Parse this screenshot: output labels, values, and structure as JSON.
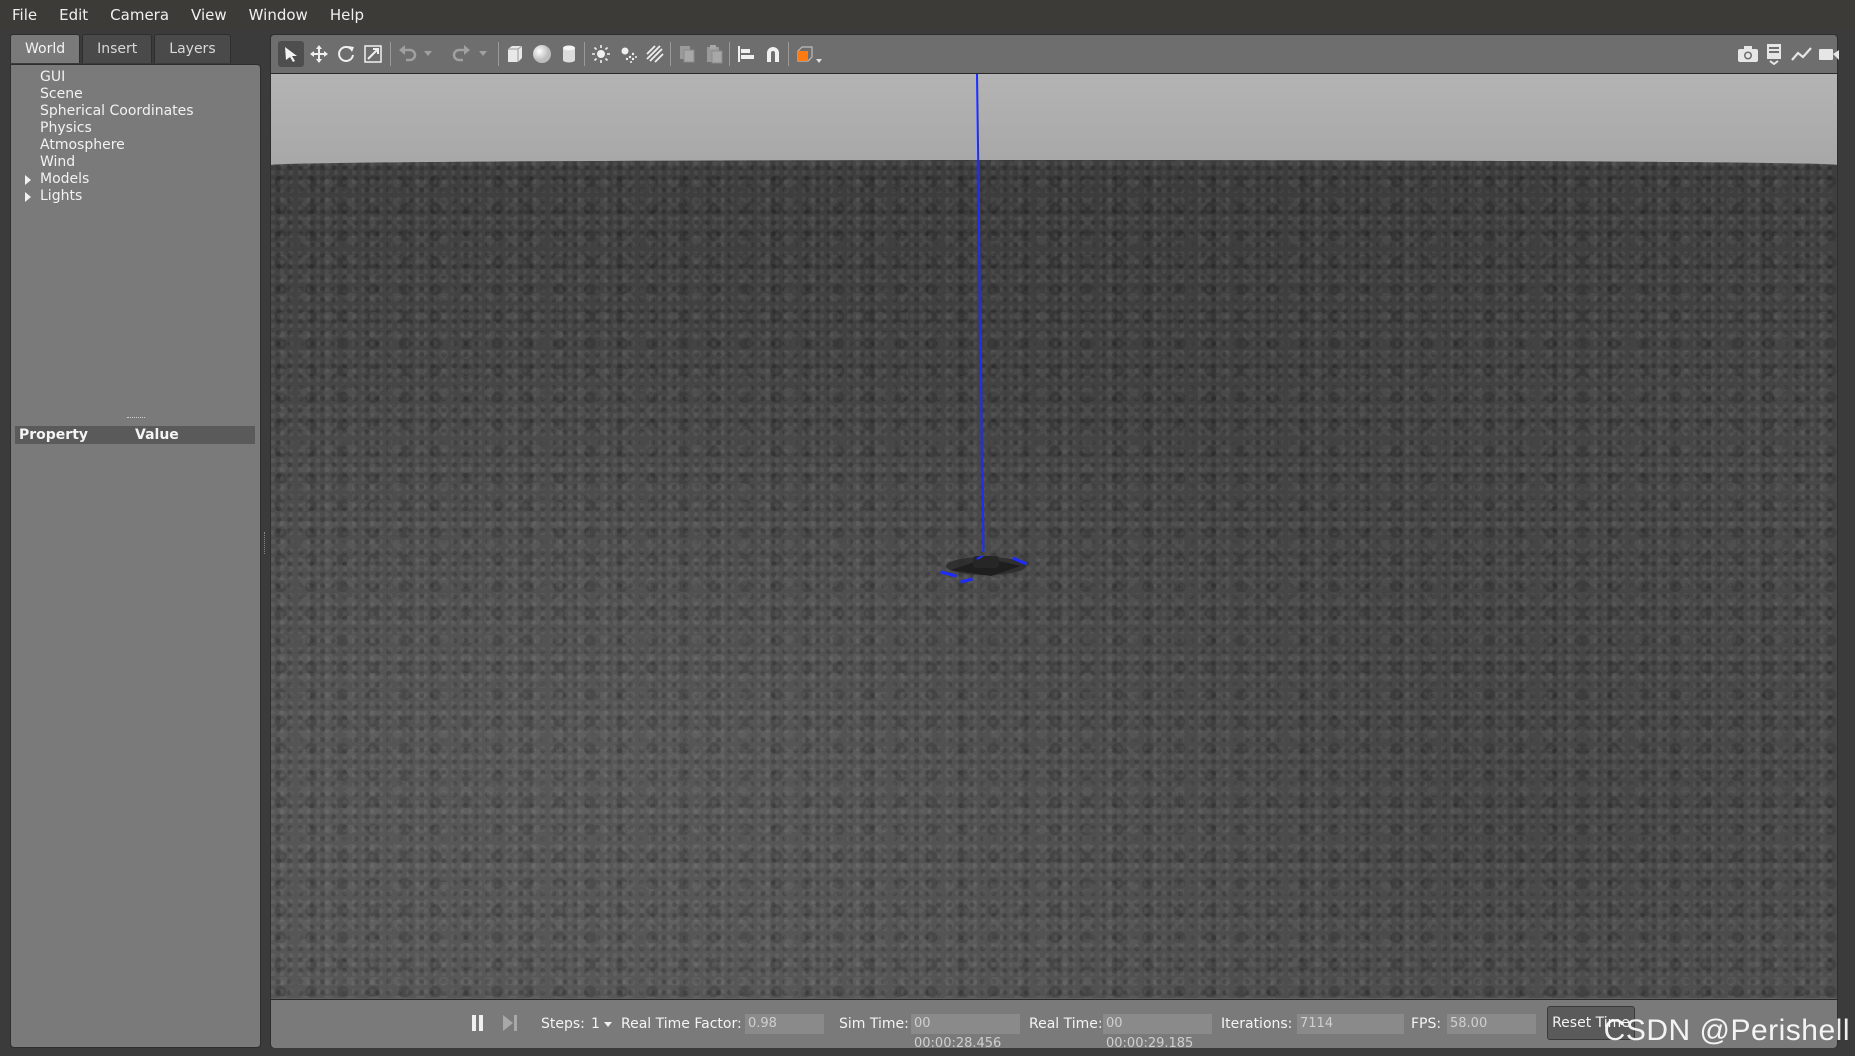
{
  "menubar": {
    "items": [
      {
        "label": "File"
      },
      {
        "label": "Edit"
      },
      {
        "label": "Camera"
      },
      {
        "label": "View"
      },
      {
        "label": "Window"
      },
      {
        "label": "Help"
      }
    ]
  },
  "left_panel": {
    "tabs": [
      {
        "label": "World",
        "active": true
      },
      {
        "label": "Insert",
        "active": false
      },
      {
        "label": "Layers",
        "active": false
      }
    ],
    "tree": [
      {
        "label": "GUI",
        "expandable": false
      },
      {
        "label": "Scene",
        "expandable": false
      },
      {
        "label": "Spherical Coordinates",
        "expandable": false
      },
      {
        "label": "Physics",
        "expandable": false
      },
      {
        "label": "Atmosphere",
        "expandable": false
      },
      {
        "label": "Wind",
        "expandable": false
      },
      {
        "label": "Models",
        "expandable": true
      },
      {
        "label": "Lights",
        "expandable": true
      }
    ],
    "properties": {
      "col_property": "Property",
      "col_value": "Value"
    }
  },
  "toolbar": {
    "tools": [
      {
        "icon": "select-arrow-icon",
        "active": true
      },
      {
        "icon": "translate-icon"
      },
      {
        "icon": "rotate-icon"
      },
      {
        "icon": "scale-icon"
      },
      {
        "icon": "undo-icon"
      },
      {
        "icon": "undo-dropdown-icon"
      },
      {
        "icon": "redo-icon"
      },
      {
        "icon": "redo-dropdown-icon"
      },
      {
        "icon": "box-shape-icon"
      },
      {
        "icon": "sphere-shape-icon"
      },
      {
        "icon": "cylinder-shape-icon"
      },
      {
        "icon": "point-light-icon"
      },
      {
        "icon": "spot-light-icon"
      },
      {
        "icon": "directional-light-icon"
      },
      {
        "icon": "copy-icon"
      },
      {
        "icon": "paste-icon"
      },
      {
        "icon": "align-icon"
      },
      {
        "icon": "snap-magnet-icon"
      },
      {
        "icon": "view-angle-cube-icon"
      },
      {
        "icon": "screenshot-camera-icon"
      },
      {
        "icon": "log-record-icon"
      },
      {
        "icon": "plot-icon"
      },
      {
        "icon": "video-record-icon"
      }
    ]
  },
  "status_bar": {
    "steps_label": "Steps:",
    "steps_value": "1",
    "rtf_label": "Real Time Factor:",
    "rtf_value": "0.98",
    "sim_time_label": "Sim Time:",
    "sim_time_value": "00 00:00:28.456",
    "real_time_label": "Real Time:",
    "real_time_value": "00 00:00:29.185",
    "iterations_label": "Iterations:",
    "iterations_value": "7114",
    "fps_label": "FPS:",
    "fps_value": "58.00",
    "reset_label": "Reset Time"
  },
  "watermark": "CSDN @Perishell",
  "colors": {
    "z_axis": "#1d2cff",
    "panel": "#7a7a7a",
    "sky": "#b0b0b0"
  }
}
